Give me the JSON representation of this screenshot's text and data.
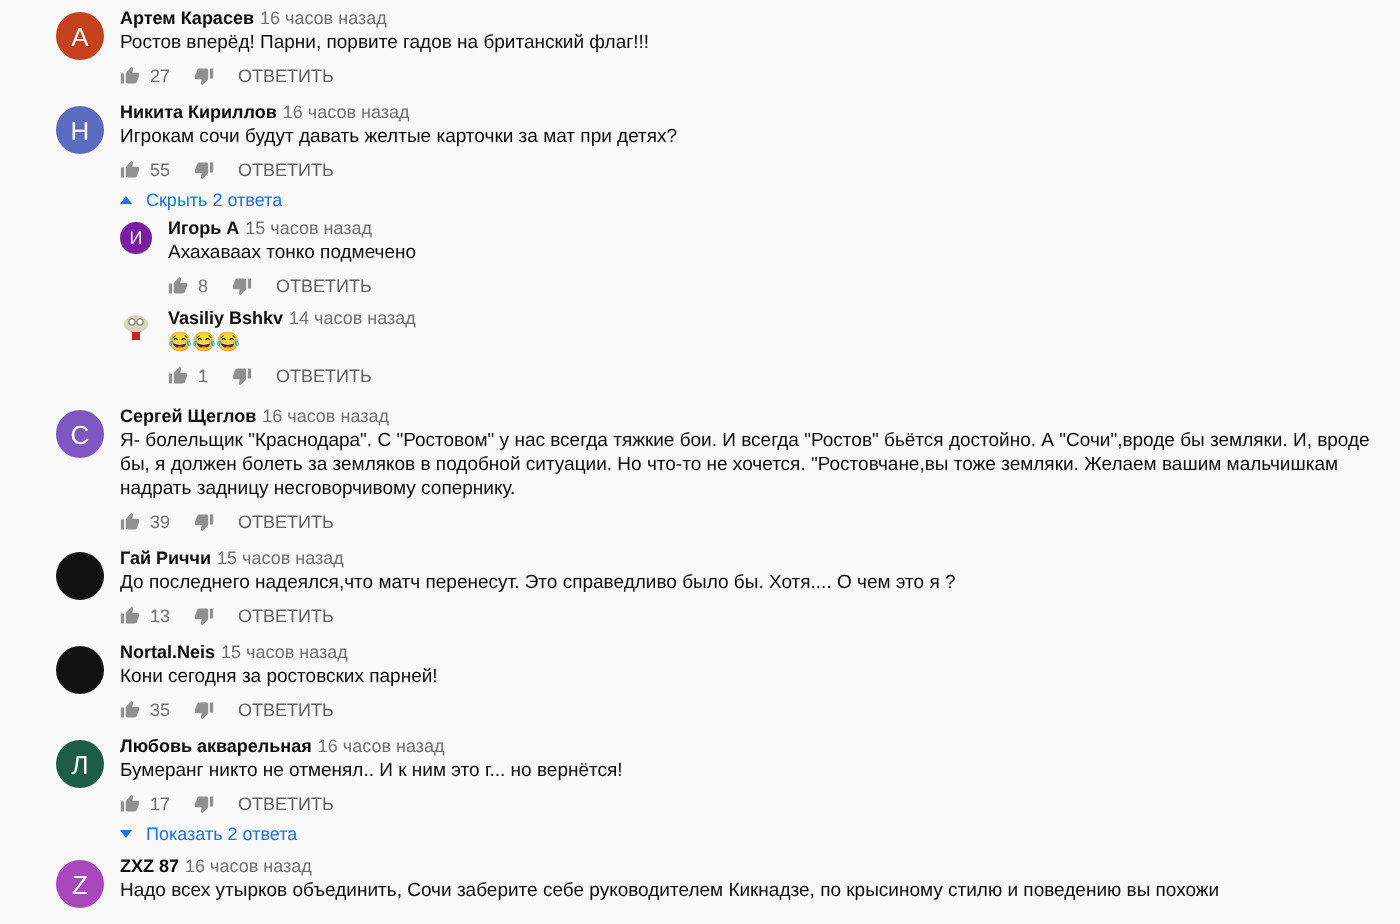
{
  "comments": [
    {
      "avatar": {
        "kind": "letter",
        "letter": "А",
        "color": "#c5401c"
      },
      "author": "Артем Карасев",
      "time": "16 часов назад",
      "text": "Ростов вперёд! Парни, порвите гадов на британский флаг!!!",
      "likes": "27",
      "reply_label": "ОТВЕТИТЬ"
    },
    {
      "avatar": {
        "kind": "letter",
        "letter": "Н",
        "color": "#5c6bc0"
      },
      "author": "Никита Кириллов",
      "time": "16 часов назад",
      "text": "Игрокам сочи будут давать желтые карточки за мат при детях?",
      "likes": "55",
      "reply_label": "ОТВЕТИТЬ",
      "replies_toggle": {
        "label": "Скрыть 2 ответа",
        "expanded": true
      },
      "replies": [
        {
          "avatar": {
            "kind": "letter",
            "letter": "И",
            "color": "#7b1fa2"
          },
          "author": "Игорь А",
          "time": "15 часов назад",
          "text": "Ахахаваах тонко подмечено",
          "likes": "8",
          "reply_label": "ОТВЕТИТЬ"
        },
        {
          "avatar": {
            "kind": "image"
          },
          "author": "Vasiliy Bshkv",
          "time": "14 часов назад",
          "text": "😂😂😂",
          "likes": "1",
          "reply_label": "ОТВЕТИТЬ"
        }
      ]
    },
    {
      "avatar": {
        "kind": "letter",
        "letter": "С",
        "color": "#7e57c2"
      },
      "author": "Сергей Щеглов",
      "time": "16 часов назад",
      "text": "Я- болельщик \"Краснодара\". С \"Ростовом\" у нас всегда тяжкие бои. И всегда \"Ростов\" бьётся достойно. А \"Сочи\",вроде бы земляки. И, вроде бы, я должен болеть за земляков в подобной ситуации. Но что-то не хочется. \"Ростовчане,вы тоже земляки. Желаем вашим мальчишкам надрать задницу несговорчивому сопернику.",
      "likes": "39",
      "reply_label": "ОТВЕТИТЬ"
    },
    {
      "avatar": {
        "kind": "image"
      },
      "author": "Гай Риччи",
      "time": "15 часов назад",
      "text": "До последнего надеялся,что матч перенесут. Это справедливо было бы. Хотя.... О чем это я ?",
      "likes": "13",
      "reply_label": "ОТВЕТИТЬ"
    },
    {
      "avatar": {
        "kind": "image"
      },
      "author": "Nortal.Neis",
      "time": "15 часов назад",
      "text": "Кони сегодня за ростовских парней!",
      "likes": "35",
      "reply_label": "ОТВЕТИТЬ"
    },
    {
      "avatar": {
        "kind": "letter",
        "letter": "Л",
        "color": "#1b5e45"
      },
      "author": "Любовь акварельная",
      "time": "16 часов назад",
      "text": "Бумеранг никто не отменял.. И к ним это г... но вернётся!",
      "likes": "17",
      "reply_label": "ОТВЕТИТЬ",
      "replies_toggle": {
        "label": "Показать 2 ответа",
        "expanded": false
      }
    },
    {
      "avatar": {
        "kind": "letter",
        "letter": "Z",
        "color": "#ab47bc"
      },
      "author": "ZXZ 87",
      "time": "16 часов назад",
      "text": "Надо всех утырков объединить, Сочи заберите себе руководителем Кикнадзе, по крысиному стилю и поведению вы похожи"
    }
  ]
}
